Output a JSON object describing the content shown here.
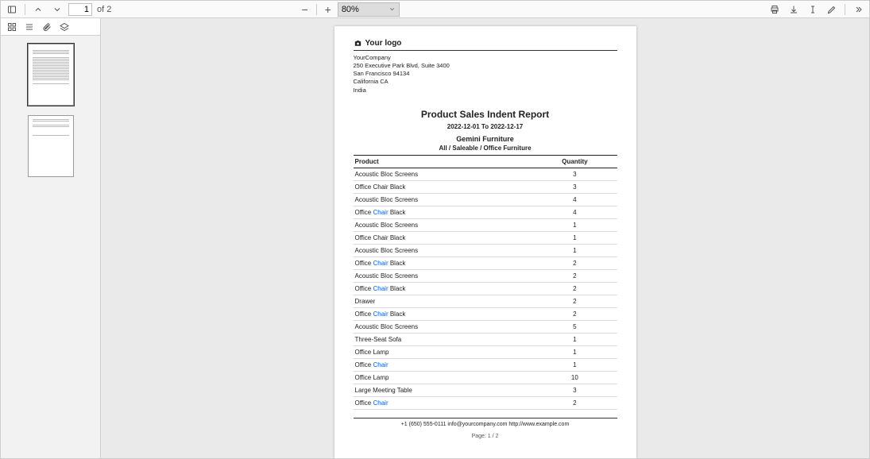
{
  "toolbar": {
    "page_current": "1",
    "page_of": "of 2",
    "zoom_value": "80%",
    "zoom_minus": "−",
    "zoom_plus": "+"
  },
  "company": {
    "logo_text": "Your logo",
    "name": "YourCompany",
    "addr1": "250 Executive Park Blvd, Suite 3400",
    "addr2": "San Francisco 94134",
    "addr3": "California CA",
    "addr4": "India"
  },
  "report": {
    "title": "Product Sales Indent Report",
    "date_range": "2022-12-01 To 2022-12-17",
    "partner": "Gemini Furniture",
    "filters": "All / Saleable / Office Furniture",
    "col_product": "Product",
    "col_qty": "Quantity",
    "rows": [
      {
        "product": "Acoustic Bloc Screens",
        "qty": "3",
        "link": false
      },
      {
        "product": "Office Chair Black",
        "qty": "3",
        "link": false
      },
      {
        "product": "Acoustic Bloc Screens",
        "qty": "4",
        "link": false
      },
      {
        "product": "Office Chair Black",
        "qty": "4",
        "link": true
      },
      {
        "product": "Acoustic Bloc Screens",
        "qty": "1",
        "link": false
      },
      {
        "product": "Office Chair Black",
        "qty": "1",
        "link": false
      },
      {
        "product": "Acoustic Bloc Screens",
        "qty": "1",
        "link": false
      },
      {
        "product": "Office Chair Black",
        "qty": "2",
        "link": true
      },
      {
        "product": "Acoustic Bloc Screens",
        "qty": "2",
        "link": false
      },
      {
        "product": "Office Chair Black",
        "qty": "2",
        "link": true
      },
      {
        "product": "Drawer",
        "qty": "2",
        "link": false
      },
      {
        "product": "Office Chair Black",
        "qty": "2",
        "link": true
      },
      {
        "product": "Acoustic Bloc Screens",
        "qty": "5",
        "link": false
      },
      {
        "product": "Three-Seat Sofa",
        "qty": "1",
        "link": false
      },
      {
        "product": "Office Lamp",
        "qty": "1",
        "link": false
      },
      {
        "product": "Office Chair",
        "qty": "1",
        "link": true
      },
      {
        "product": "Office Lamp",
        "qty": "10",
        "link": false
      },
      {
        "product": "Large Meeting Table",
        "qty": "3",
        "link": false
      },
      {
        "product": "Office Chair",
        "qty": "2",
        "link": true
      }
    ],
    "footer_contact": "+1 (650) 555-0111 info@yourcompany.com http://www.example.com",
    "page_label": "Page: 1 / 2"
  }
}
